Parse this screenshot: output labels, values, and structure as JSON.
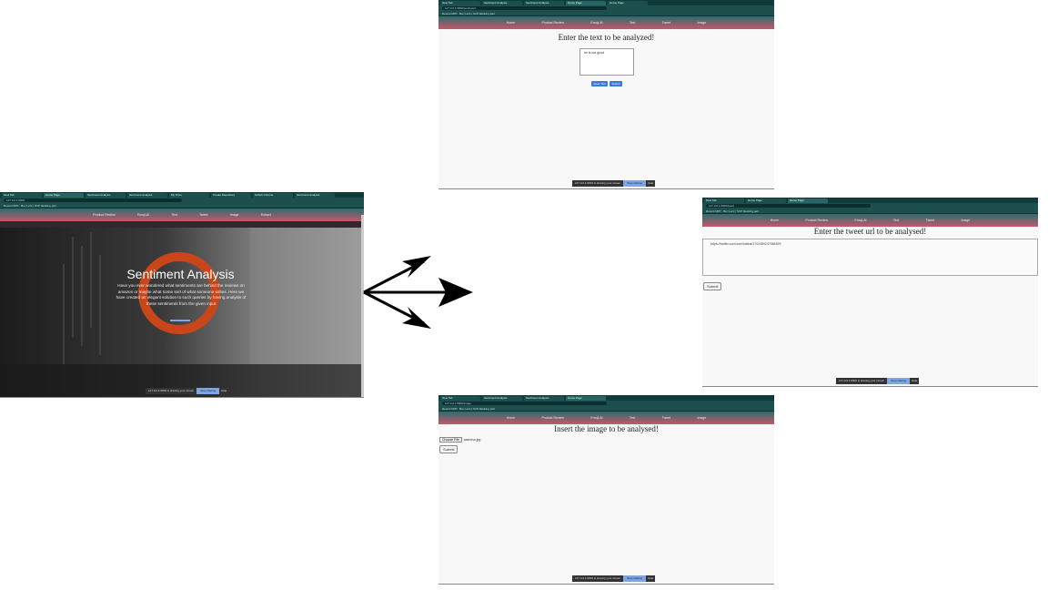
{
  "home": {
    "tabs": [
      "New Tab",
      "Home Page",
      "Sentiment Analysis",
      "Sentiment Analysis",
      "My Drive",
      "Create Repository",
      "Github Chrome",
      "Sentiment Analysis"
    ],
    "address": "127.0.0.1:5000",
    "bookmarks": "Recent DPP · Ba  |  Let's  |  SVP blanking part",
    "nav": [
      "Product Review",
      "Emoji-Al",
      "Text",
      "Tweet",
      "Image",
      "Extract"
    ],
    "hero_title": "Sentiment Analysis",
    "hero_text": "Have you ever wondered what sentiments are behind the reviews on amazon or maybe what some sort of what someone writes. Here we have created an elegant solution to such queries by having analysis of these sentiments from the given input",
    "share_bar": {
      "message": "127.0.0.1:5000 is sharing your screen",
      "stop": "Stop sharing",
      "hide": "Hide"
    }
  },
  "text_page": {
    "tabs": [
      "New Tab",
      "Sentiment Analysis",
      "Sentiment Analysis",
      "Home Page",
      "Home Page"
    ],
    "address": "127.0.0.1:5000/sentiment",
    "bookmarks": "Recent DPP · Ba  |  Let's  |  SVP blanking part",
    "nav": [
      "Home",
      "Product Review",
      "Emoji-Al",
      "Text",
      "Tweet",
      "Image"
    ],
    "heading": "Enter the text to be analyzed!",
    "textarea_value": "he is not good",
    "btn_clear": "Clear Text",
    "btn_submit": "Submit",
    "share_bar": {
      "message": "127.0.0.1:5000 is sharing your screen",
      "stop": "Stop sharing",
      "hide": "Hide"
    }
  },
  "tweet_page": {
    "tabs": [
      "New Tab",
      "Home Page",
      "Home Page"
    ],
    "address": "127.0.0.1:5000/tweet",
    "bookmarks": "Recent DPP · Ba  |  Let's  |  SVP blanking part",
    "nav": [
      "Home",
      "Product Review",
      "Emoji-Al",
      "Text",
      "Tweet",
      "Image"
    ],
    "heading": "Enter the tweet url to be analysed!",
    "input_value": "https://twitter.com/user/status/1702489247984599",
    "btn_submit": "Submit",
    "share_bar": {
      "message": "127.0.0.1:5000 is sharing your screen",
      "stop": "Stop sharing",
      "hide": "Hide"
    }
  },
  "image_page": {
    "tabs": [
      "New Tab",
      "Sentiment Analysis",
      "Sentiment Analysis",
      "Home Page"
    ],
    "address": "127.0.0.1:5000/image",
    "bookmarks": "Recent DPP · Ba  |  Let's  |  SVP blanking part",
    "nav": [
      "Home",
      "Product Review",
      "Emoji-Al",
      "Text",
      "Tweet",
      "Image"
    ],
    "heading": "Insert the image to be analysed!",
    "file_button": "Choose File",
    "file_name": "sadness.jpg",
    "btn_submit": "Submit",
    "share_bar": {
      "message": "127.0.0.1:5000 is sharing your screen",
      "stop": "Stop sharing",
      "hide": "Hide"
    }
  },
  "colors": {
    "chrome": "#0f3b3b",
    "nav_top": "#2d6d6d",
    "nav_bottom": "#c4586a",
    "accent_ring": "#c8461a",
    "share_button": "#7ea6e0"
  }
}
